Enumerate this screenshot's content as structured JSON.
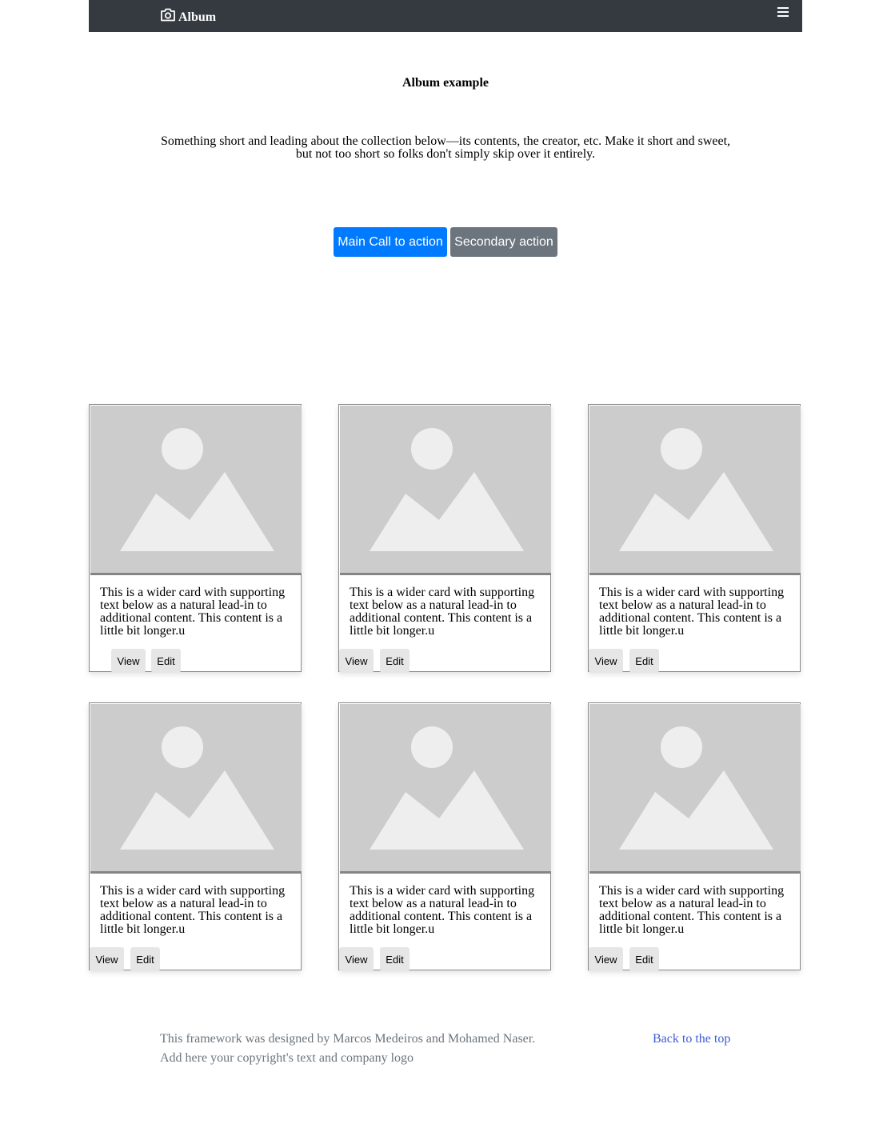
{
  "navbar": {
    "brand_label": "Album",
    "brand_icon": "camera-icon",
    "menu_icon": "hamburger-icon"
  },
  "hero": {
    "title": "Album example",
    "lead": "Something short and leading about the collection below—its contents, the creator, etc. Make it short and sweet, but not too short so folks don't simply skip over it entirely.",
    "primary_label": "Main Call to action",
    "secondary_label": "Secondary action"
  },
  "cards": [
    {
      "text": "This is a wider card with supporting text below as a natural lead-in to additional content. This content is a little bit longer.u",
      "view_label": "View",
      "edit_label": "Edit"
    },
    {
      "text": "This is a wider card with supporting text below as a natural lead-in to additional content. This content is a little bit longer.u",
      "view_label": "View",
      "edit_label": "Edit"
    },
    {
      "text": "This is a wider card with supporting text below as a natural lead-in to additional content. This content is a little bit longer.u",
      "view_label": "View",
      "edit_label": "Edit"
    },
    {
      "text": "This is a wider card with supporting text below as a natural lead-in to additional content. This content is a little bit longer.u",
      "view_label": "View",
      "edit_label": "Edit"
    },
    {
      "text": "This is a wider card with supporting text below as a natural lead-in to additional content. This content is a little bit longer.u",
      "view_label": "View",
      "edit_label": "Edit"
    },
    {
      "text": "This is a wider card with supporting text below as a natural lead-in to additional content. This content is a little bit longer.u",
      "view_label": "View",
      "edit_label": "Edit"
    }
  ],
  "footer": {
    "credit": "This framework was designed by Marcos Medeiros and Mohamed Naser.",
    "copyright": "Add here your copyright's text and company logo",
    "back_to_top": "Back to the top"
  },
  "colors": {
    "navbar_bg": "#343a40",
    "primary": "#007bff",
    "secondary": "#6c757d",
    "link": "#3e5bd7",
    "placeholder_bg": "#cccccc",
    "placeholder_shape": "#eeeeee"
  }
}
